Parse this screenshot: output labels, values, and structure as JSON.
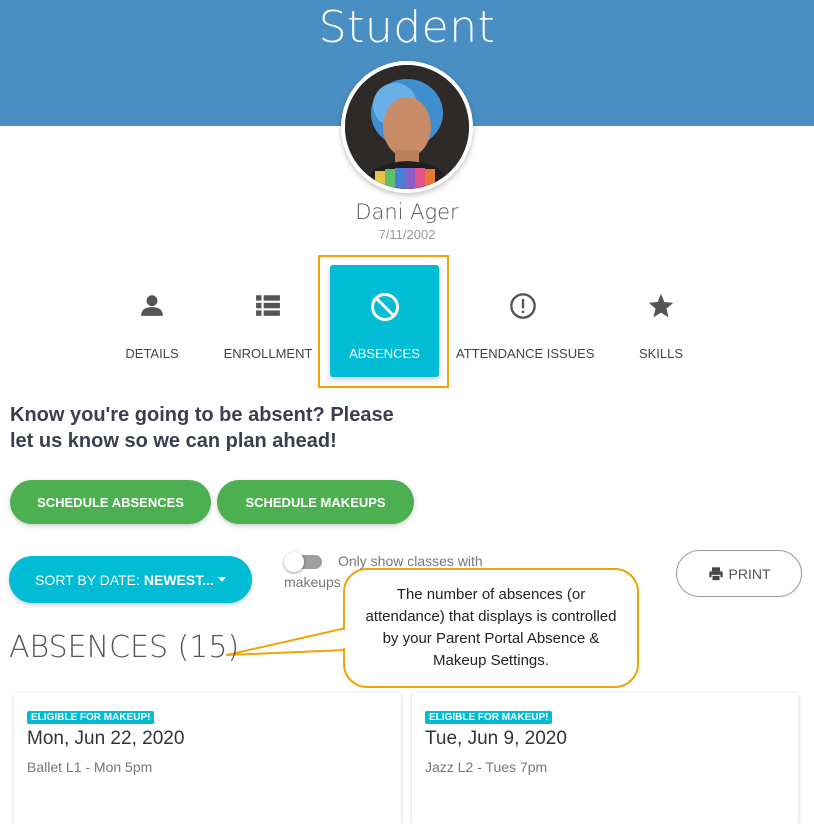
{
  "header": {
    "title": "Student"
  },
  "student": {
    "name": "Dani Ager",
    "dob": "7/11/2002"
  },
  "tabs": [
    {
      "label": "DETAILS",
      "icon": "person-icon"
    },
    {
      "label": "ENROLLMENT",
      "icon": "list-icon"
    },
    {
      "label": "ABSENCES",
      "icon": "block-icon",
      "active": true
    },
    {
      "label": "ATTENDANCE ISSUES",
      "icon": "alert-circle-icon"
    },
    {
      "label": "SKILLS",
      "icon": "star-icon"
    }
  ],
  "prompt": "Know you're going to be absent? Please let us know so we can plan ahead!",
  "actions": {
    "schedule_absences": "SCHEDULE ABSENCES",
    "schedule_makeups": "SCHEDULE MAKEUPS"
  },
  "sort": {
    "prefix": "SORT BY DATE:",
    "value": "NEWEST..."
  },
  "toggle": {
    "label_line1": "Only show classes with",
    "label_line2": "makeups",
    "on": false
  },
  "print": {
    "label": "PRINT"
  },
  "callout": {
    "text": "The number of absences (or attendance) that displays is controlled by your Parent Portal Absence & Makeup Settings."
  },
  "absences": {
    "heading": "ABSENCES (15)",
    "items": [
      {
        "badge": "ELIGIBLE FOR MAKEUP!",
        "date": "Mon, Jun 22, 2020",
        "class": "Ballet L1 - Mon 5pm"
      },
      {
        "badge": "ELIGIBLE FOR MAKEUP!",
        "date": "Tue, Jun 9, 2020",
        "class": "Jazz L2 - Tues 7pm"
      }
    ]
  },
  "colors": {
    "header": "#4a8fc4",
    "accent": "#00bcd4",
    "green": "#4caf50",
    "callout_border": "#f0a30a"
  }
}
